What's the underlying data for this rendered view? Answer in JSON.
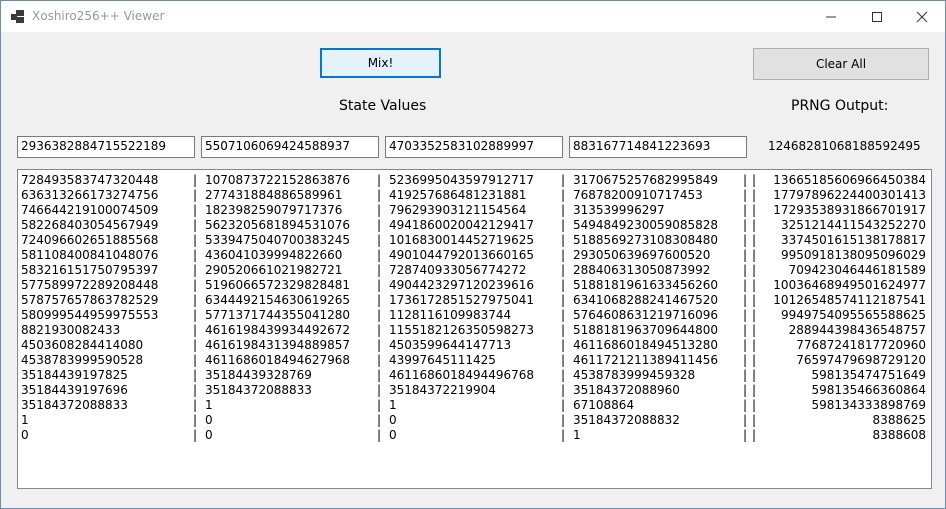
{
  "window": {
    "title": "Xoshiro256++ Viewer"
  },
  "buttons": {
    "mix_label": "Mix!",
    "clear_label": "Clear All"
  },
  "labels": {
    "state_values": "State Values",
    "prng_output": "PRNG Output:"
  },
  "state_inputs": [
    "2936382884715522189",
    "5507106069424588937",
    "4703352583102889997",
    "883167714841223693"
  ],
  "output_value": "12468281068188592495",
  "separator": "|",
  "rows": [
    [
      "728493583747320448",
      "10708737221528638​76",
      "5236995043597912717",
      "3170675257682995849",
      "13665185606966450384"
    ],
    [
      "636313266173274756",
      "2774318848865899​61",
      "4192576864812318​81",
      "768782009107174​53",
      "17797896224400301413"
    ],
    [
      "746644219100074509",
      "1823982590797173​76",
      "7962939031211545​64",
      "313539996297",
      "17293538931866701917"
    ],
    [
      "5822684030545679​49",
      "5623205681894531076",
      "4941860020042129417",
      "5494849230059085828",
      "3251214411543252270"
    ],
    [
      "724096602651885568",
      "5339475040700383245",
      "1016830014452719625",
      "5188569273108308480",
      "3374501615138178817"
    ],
    [
      "581108400841048076",
      "436041039994822660",
      "4901044792013660165",
      "293050639697600520",
      "9950918138095096029"
    ],
    [
      "583216151750795397",
      "290520661021982721",
      "728740933056774272",
      "288406313050873992",
      "709423046446181589"
    ],
    [
      "577589972289208448",
      "5196066572329828481",
      "4904423297120239616",
      "5188181961633456260",
      "10036468949501624977"
    ],
    [
      "578757657863782529",
      "6344492154630619265",
      "1736172851527975041",
      "6341068288241467520",
      "10126548574112187541"
    ],
    [
      "580999544959975553",
      "5771371744355041280",
      "1128116109983744",
      "5764608631219716096",
      "9949754095565588625"
    ],
    [
      "8821930082433",
      "4616198439934492672",
      "1155182126350598273",
      "5188181963709644800",
      "288944398436548757"
    ],
    [
      "4503608284414080",
      "4616198431394889857",
      "4503599644147713",
      "4611686018494513280",
      "77687241817720960"
    ],
    [
      "4538783999590528",
      "4611686018494627968",
      "43997645111425",
      "4611721211389411456",
      "76597479698729120"
    ],
    [
      "35184439197825",
      "35184439328769",
      "4611686018494496768",
      "4538783999459328",
      "598135474751649"
    ],
    [
      "35184439197696",
      "35184372088833",
      "35184372219904",
      "35184372088960",
      "598135466360864"
    ],
    [
      "35184372088833",
      "1",
      "1",
      "67108864",
      "598134333898769"
    ],
    [
      "1",
      "0",
      "0",
      "35184372088832",
      "8388625"
    ],
    [
      "0",
      "0",
      "0",
      "1",
      "8388608"
    ]
  ]
}
